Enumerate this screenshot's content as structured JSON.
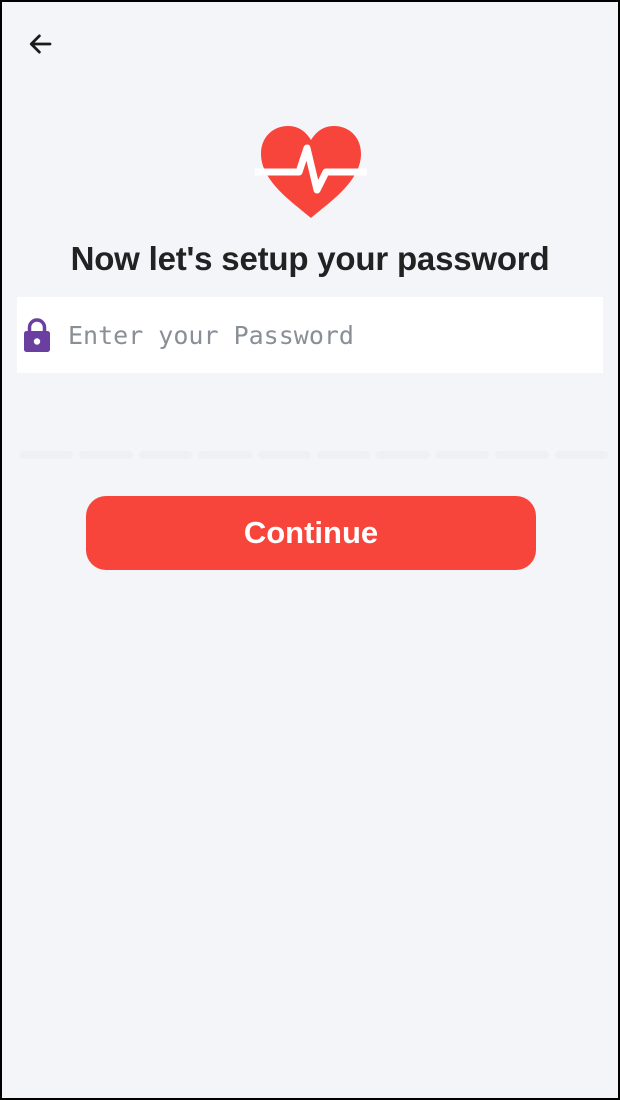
{
  "header": {
    "back_icon": "arrow-left-icon"
  },
  "logo": {
    "icon": "heart-pulse-icon",
    "color": "#f8453b"
  },
  "title": "Now let's setup your password",
  "password_field": {
    "icon": "lock-icon",
    "icon_color": "#6a3fa0",
    "value": "",
    "placeholder": "Enter your Password"
  },
  "strength_meter": {
    "segment_count": 10,
    "filled_segments": 0
  },
  "continue_button": {
    "label": "Continue",
    "color": "#f8453b"
  }
}
